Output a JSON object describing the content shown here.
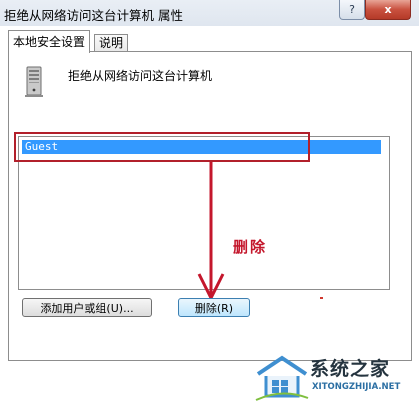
{
  "window": {
    "title": "拒绝从网络访问这台计算机 属性",
    "help_label": "?",
    "close_label": "x"
  },
  "tabs": [
    {
      "label": "本地安全设置",
      "active": true
    },
    {
      "label": "说明",
      "active": false
    }
  ],
  "policy": {
    "title": "拒绝从网络访问这台计算机",
    "icon": "server-icon"
  },
  "list": {
    "items": [
      "Guest"
    ],
    "selected": "Guest"
  },
  "annotation": {
    "text": "删除",
    "color": "#c4172c"
  },
  "buttons": {
    "add_label": "添加用户或组(U)...",
    "remove_label": "删除(R)"
  },
  "watermark": {
    "site_name": "系统之家",
    "url": "XITONGZHIJIA.NET"
  },
  "colors": {
    "selection": "#3399ff",
    "annotation": "#c4172c"
  }
}
